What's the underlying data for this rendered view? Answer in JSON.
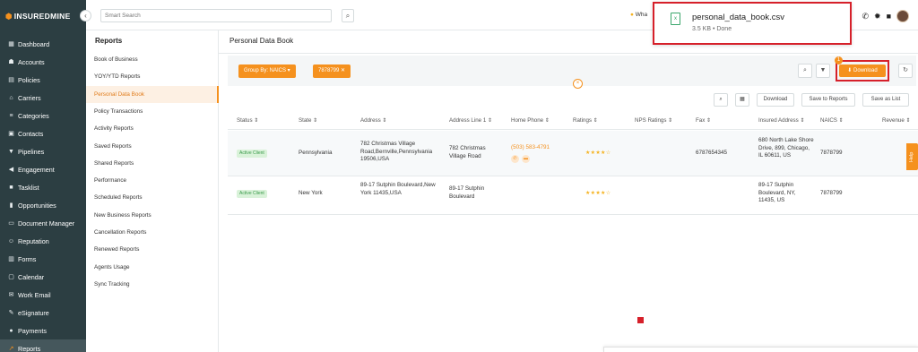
{
  "brand": {
    "name": "INSUREDMINE"
  },
  "sidebar": {
    "items": [
      {
        "label": "Dashboard",
        "icon": "dashboard-icon",
        "glyph": "▦"
      },
      {
        "label": "Accounts",
        "icon": "accounts-icon",
        "glyph": "☗"
      },
      {
        "label": "Policies",
        "icon": "policies-icon",
        "glyph": "▤"
      },
      {
        "label": "Carriers",
        "icon": "carriers-icon",
        "glyph": "⌂"
      },
      {
        "label": "Categories",
        "icon": "categories-icon",
        "glyph": "≡"
      },
      {
        "label": "Contacts",
        "icon": "contacts-icon",
        "glyph": "▣"
      },
      {
        "label": "Pipelines",
        "icon": "pipelines-icon",
        "glyph": "▼"
      },
      {
        "label": "Engagement",
        "icon": "engagement-icon",
        "glyph": "◀"
      },
      {
        "label": "Tasklist",
        "icon": "tasklist-icon",
        "glyph": "■"
      },
      {
        "label": "Opportunities",
        "icon": "opportunities-icon",
        "glyph": "▮"
      },
      {
        "label": "Document Manager",
        "icon": "document-manager-icon",
        "glyph": "▭"
      },
      {
        "label": "Reputation",
        "icon": "reputation-icon",
        "glyph": "☺"
      },
      {
        "label": "Forms",
        "icon": "forms-icon",
        "glyph": "▥"
      },
      {
        "label": "Calendar",
        "icon": "calendar-icon",
        "glyph": "▢"
      },
      {
        "label": "Work Email",
        "icon": "work-email-icon",
        "glyph": "✉"
      },
      {
        "label": "eSignature",
        "icon": "esignature-icon",
        "glyph": "✎"
      },
      {
        "label": "Payments",
        "icon": "payments-icon",
        "glyph": "●"
      },
      {
        "label": "Reports",
        "icon": "reports-icon",
        "glyph": "↗",
        "active": true
      }
    ]
  },
  "topbar": {
    "search_placeholder": "Smart Search",
    "whats_new": "Wha",
    "icons": [
      "phone-icon",
      "settings-icon",
      "notification-icon"
    ]
  },
  "download_popup": {
    "file_name": "personal_data_book.csv",
    "meta": "3.5 KB • Done"
  },
  "submenu": {
    "title": "Reports",
    "items": [
      "Book of Business",
      "YOY/YTD Reports",
      "Personal Data Book",
      "Policy Transactions",
      "Activity Reports",
      "Saved Reports",
      "Shared Reports",
      "Performance",
      "Scheduled Reports",
      "New Business Reports",
      "Cancellation Reports",
      "Renewed Reports",
      "Agents Usage",
      "Sync Tracking"
    ],
    "active_index": 2
  },
  "main": {
    "title": "Personal Data Book",
    "filters": {
      "group_by": "Group By: NAICS",
      "naics_chip": "7878799"
    },
    "badge_count": "1",
    "download_label": "Download",
    "table_toolbar": {
      "download": "Download",
      "save_to_reports": "Save to Reports",
      "save_as_list": "Save as List"
    },
    "columns": [
      "Status",
      "State",
      "Address",
      "Address Line 1",
      "Home Phone",
      "Ratings",
      "NPS Ratings",
      "Fax",
      "Insured Address",
      "NAICS",
      "Revenue"
    ],
    "rows": [
      {
        "status": "Active Client",
        "state": "Pennsylvania",
        "address": "782 Christmas Village Road,Bernville,Pennsylvania 19506,USA",
        "address_line1": "782 Christmas Village Road",
        "home_phone": "(503) 583-4791",
        "ratings": 4,
        "fax": "6787654345",
        "insured_address": "680 North Lake Shore Drive, 899, Chicago, IL 60611, US",
        "naics": "7878799"
      },
      {
        "status": "Active Client",
        "state": "New York",
        "address": "89-17 Sutphin Boulevard,New York 11435,USA",
        "address_line1": "89-17 Sutphin Boulevard",
        "home_phone": "",
        "ratings": 4,
        "fax": "",
        "insured_address": "89-17 Sutphin Boulevard, NY, 11435, US",
        "naics": "7878799"
      }
    ]
  },
  "help_label": "Help",
  "colors": {
    "accent": "#f5911e",
    "sidebar_bg": "#2c3e42",
    "highlight_red": "#d6202a",
    "active_status_bg": "#d9f2d9"
  }
}
